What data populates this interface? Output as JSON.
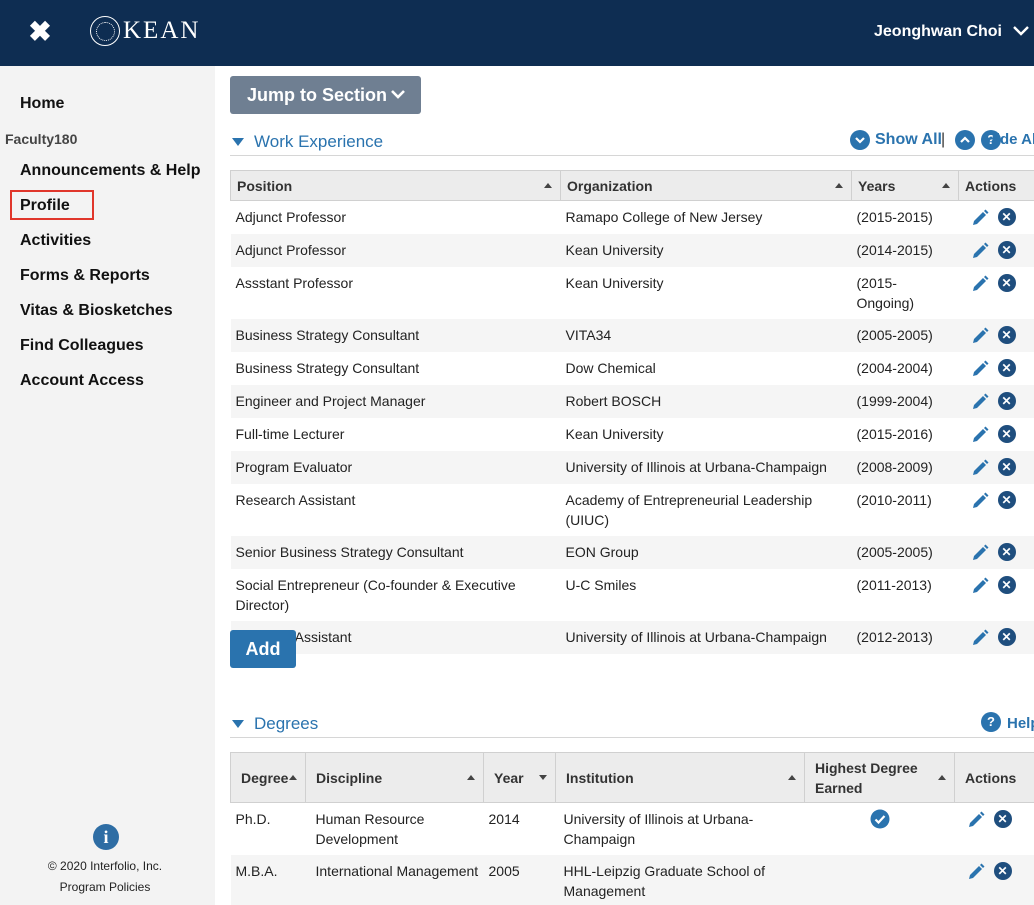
{
  "header": {
    "brand": "KEAN",
    "user_name": "Jeonghwan Choi"
  },
  "sidebar": {
    "home": "Home",
    "section_label": "Faculty180",
    "items": [
      {
        "label": "Announcements & Help"
      },
      {
        "label": "Profile"
      },
      {
        "label": "Activities"
      },
      {
        "label": "Forms & Reports"
      },
      {
        "label": "Vitas & Biosketches"
      },
      {
        "label": "Find Colleagues"
      },
      {
        "label": "Account Access"
      }
    ],
    "copyright": "© 2020 Interfolio, Inc.",
    "policies": "Program Policies"
  },
  "main": {
    "jump_label": "Jump to Section",
    "work": {
      "title": "Work Experience",
      "show_all": "Show All",
      "separator": "|",
      "help_fragment": "Hide All Help",
      "columns": [
        "Position",
        "Organization",
        "Years",
        "Actions"
      ],
      "rows": [
        {
          "position": "Adjunct Professor",
          "organization": "Ramapo College of New Jersey",
          "years": "(2015-2015)"
        },
        {
          "position": "Adjunct Professor",
          "organization": "Kean University",
          "years": "(2014-2015)"
        },
        {
          "position": "Assstant Professor",
          "organization": "Kean University",
          "years": "(2015-Ongoing)"
        },
        {
          "position": "Business Strategy Consultant",
          "organization": "VITA34",
          "years": "(2005-2005)"
        },
        {
          "position": "Business Strategy Consultant",
          "organization": "Dow Chemical",
          "years": "(2004-2004)"
        },
        {
          "position": "Engineer and Project Manager",
          "organization": "Robert BOSCH",
          "years": "(1999-2004)"
        },
        {
          "position": "Full-time Lecturer",
          "organization": "Kean University",
          "years": "(2015-2016)"
        },
        {
          "position": "Program Evaluator",
          "organization": "University of Illinois at Urbana-Champaign",
          "years": "(2008-2009)"
        },
        {
          "position": "Research Assistant",
          "organization": "Academy of Entrepreneurial Leadership (UIUC)",
          "years": "(2010-2011)"
        },
        {
          "position": "Senior Business Strategy Consultant",
          "organization": "EON Group",
          "years": "(2005-2005)"
        },
        {
          "position": "Social Entrepreneur (Co-founder & Executive Director)",
          "organization": "U-C Smiles",
          "years": "(2011-2013)"
        },
        {
          "position": "Teaching Assistant",
          "organization": "University of Illinois at Urbana-Champaign",
          "years": "(2012-2013)"
        }
      ],
      "add_label": "Add"
    },
    "degrees": {
      "title": "Degrees",
      "help": "Help",
      "columns": [
        "Degree",
        "Discipline",
        "Year",
        "Institution",
        "Highest Degree Earned",
        "Actions"
      ],
      "rows": [
        {
          "degree": "Ph.D.",
          "discipline": "Human Resource Development",
          "year": "2014",
          "institution": "University of Illinois at Urbana-Champaign",
          "highest": true
        },
        {
          "degree": "M.B.A.",
          "discipline": "International Management",
          "year": "2005",
          "institution": "HHL-Leipzig Graduate School of Management",
          "highest": false
        }
      ]
    }
  }
}
